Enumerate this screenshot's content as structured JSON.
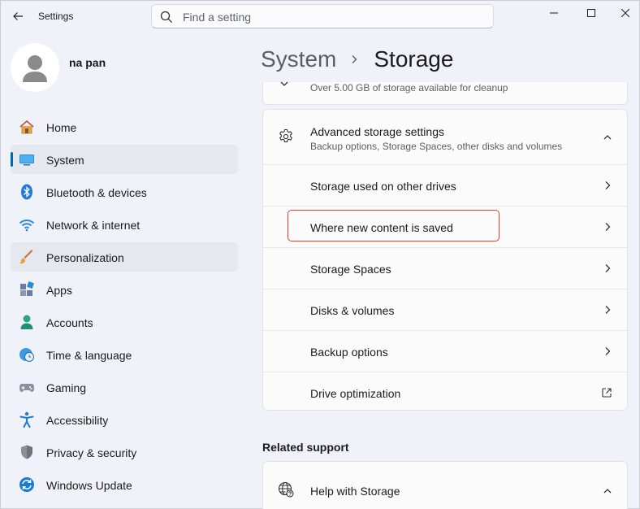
{
  "window": {
    "app_title": "Settings"
  },
  "search": {
    "placeholder": "Find a setting",
    "value": ""
  },
  "profile": {
    "user_name": "na pan"
  },
  "sidebar": {
    "items": [
      {
        "label": "Home",
        "icon": "home-icon"
      },
      {
        "label": "System",
        "icon": "system-icon",
        "selected": true
      },
      {
        "label": "Bluetooth & devices",
        "icon": "bluetooth-icon"
      },
      {
        "label": "Network & internet",
        "icon": "wifi-icon"
      },
      {
        "label": "Personalization",
        "icon": "brush-icon"
      },
      {
        "label": "Apps",
        "icon": "apps-icon"
      },
      {
        "label": "Accounts",
        "icon": "accounts-icon"
      },
      {
        "label": "Time & language",
        "icon": "clock-globe-icon"
      },
      {
        "label": "Gaming",
        "icon": "gamepad-icon"
      },
      {
        "label": "Accessibility",
        "icon": "accessibility-icon"
      },
      {
        "label": "Privacy & security",
        "icon": "shield-icon"
      },
      {
        "label": "Windows Update",
        "icon": "update-icon"
      }
    ]
  },
  "breadcrumb": {
    "parent": "System",
    "current": "Storage"
  },
  "cleanup": {
    "text": "Over 5.00 GB of storage available for cleanup"
  },
  "advanced": {
    "title": "Advanced storage settings",
    "subtitle": "Backup options, Storage Spaces, other disks and volumes",
    "rows": [
      {
        "label": "Storage used on other drives",
        "action": "chevron-right-icon"
      },
      {
        "label": "Where new content is saved",
        "action": "chevron-right-icon",
        "highlighted": true
      },
      {
        "label": "Storage Spaces",
        "action": "chevron-right-icon"
      },
      {
        "label": "Disks & volumes",
        "action": "chevron-right-icon"
      },
      {
        "label": "Backup options",
        "action": "chevron-right-icon"
      },
      {
        "label": "Drive optimization",
        "action": "external-link-icon"
      }
    ]
  },
  "related": {
    "title": "Related support",
    "help_title": "Help with Storage"
  },
  "colors": {
    "accent": "#0067c0",
    "highlight": "#d0412c",
    "window_bg": "#eff2f8",
    "card_bg": "#fbfbfc"
  }
}
